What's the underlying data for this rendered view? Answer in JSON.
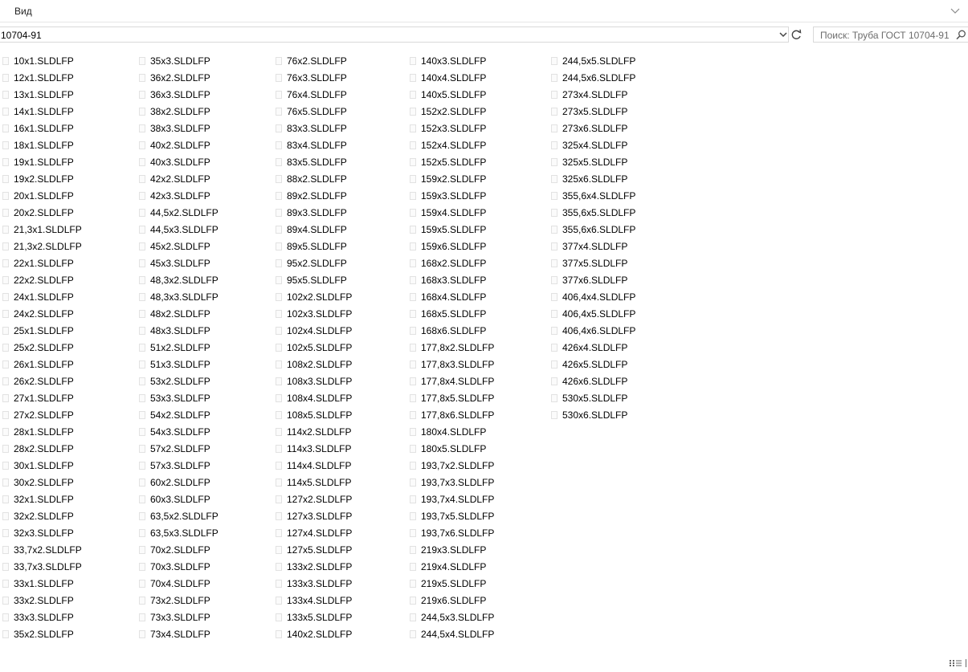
{
  "ribbon": {
    "tab_label": "Вид"
  },
  "address": {
    "path": "10704-91"
  },
  "search": {
    "placeholder": "Поиск: Труба ГОСТ 10704-91"
  },
  "icons": {
    "ribbon": "chevron-down-icon",
    "address": "chevron-down-icon",
    "refresh": "refresh-icon",
    "search": "search-icon",
    "file": "file-icon",
    "view": "details-view-icon"
  },
  "columns": [
    [
      "10x1.SLDLFP",
      "12x1.SLDLFP",
      "13x1.SLDLFP",
      "14x1.SLDLFP",
      "16x1.SLDLFP",
      "18x1.SLDLFP",
      "19x1.SLDLFP",
      "19x2.SLDLFP",
      "20x1.SLDLFP",
      "20x2.SLDLFP",
      "21,3x1.SLDLFP",
      "21,3x2.SLDLFP",
      "22x1.SLDLFP",
      "22x2.SLDLFP",
      "24x1.SLDLFP",
      "24x2.SLDLFP",
      "25x1.SLDLFP",
      "25x2.SLDLFP",
      "26x1.SLDLFP",
      "26x2.SLDLFP",
      "27x1.SLDLFP",
      "27x2.SLDLFP",
      "28x1.SLDLFP",
      "28x2.SLDLFP",
      "30x1.SLDLFP",
      "30x2.SLDLFP",
      "32x1.SLDLFP",
      "32x2.SLDLFP",
      "32x3.SLDLFP",
      "33,7x2.SLDLFP",
      "33,7x3.SLDLFP",
      "33x1.SLDLFP",
      "33x2.SLDLFP",
      "33x3.SLDLFP",
      "35x2.SLDLFP"
    ],
    [
      "35x3.SLDLFP",
      "36x2.SLDLFP",
      "36x3.SLDLFP",
      "38x2.SLDLFP",
      "38x3.SLDLFP",
      "40x2.SLDLFP",
      "40x3.SLDLFP",
      "42x2.SLDLFP",
      "42x3.SLDLFP",
      "44,5x2.SLDLFP",
      "44,5x3.SLDLFP",
      "45x2.SLDLFP",
      "45x3.SLDLFP",
      "48,3x2.SLDLFP",
      "48,3x3.SLDLFP",
      "48x2.SLDLFP",
      "48x3.SLDLFP",
      "51x2.SLDLFP",
      "51x3.SLDLFP",
      "53x2.SLDLFP",
      "53x3.SLDLFP",
      "54x2.SLDLFP",
      "54x3.SLDLFP",
      "57x2.SLDLFP",
      "57x3.SLDLFP",
      "60x2.SLDLFP",
      "60x3.SLDLFP",
      "63,5x2.SLDLFP",
      "63,5x3.SLDLFP",
      "70x2.SLDLFP",
      "70x3.SLDLFP",
      "70x4.SLDLFP",
      "73x2.SLDLFP",
      "73x3.SLDLFP",
      "73x4.SLDLFP"
    ],
    [
      "76x2.SLDLFP",
      "76x3.SLDLFP",
      "76x4.SLDLFP",
      "76x5.SLDLFP",
      "83x3.SLDLFP",
      "83x4.SLDLFP",
      "83x5.SLDLFP",
      "88x2.SLDLFP",
      "89x2.SLDLFP",
      "89x3.SLDLFP",
      "89x4.SLDLFP",
      "89x5.SLDLFP",
      "95x2.SLDLFP",
      "95x5.SLDLFP",
      "102x2.SLDLFP",
      "102x3.SLDLFP",
      "102x4.SLDLFP",
      "102x5.SLDLFP",
      "108x2.SLDLFP",
      "108x3.SLDLFP",
      "108x4.SLDLFP",
      "108x5.SLDLFP",
      "114x2.SLDLFP",
      "114x3.SLDLFP",
      "114x4.SLDLFP",
      "114x5.SLDLFP",
      "127x2.SLDLFP",
      "127x3.SLDLFP",
      "127x4.SLDLFP",
      "127x5.SLDLFP",
      "133x2.SLDLFP",
      "133x3.SLDLFP",
      "133x4.SLDLFP",
      "133x5.SLDLFP",
      "140x2.SLDLFP"
    ],
    [
      "140x3.SLDLFP",
      "140x4.SLDLFP",
      "140x5.SLDLFP",
      "152x2.SLDLFP",
      "152x3.SLDLFP",
      "152x4.SLDLFP",
      "152x5.SLDLFP",
      "159x2.SLDLFP",
      "159x3.SLDLFP",
      "159x4.SLDLFP",
      "159x5.SLDLFP",
      "159x6.SLDLFP",
      "168x2.SLDLFP",
      "168x3.SLDLFP",
      "168x4.SLDLFP",
      "168x5.SLDLFP",
      "168x6.SLDLFP",
      "177,8x2.SLDLFP",
      "177,8x3.SLDLFP",
      "177,8x4.SLDLFP",
      "177,8x5.SLDLFP",
      "177,8x6.SLDLFP",
      "180x4.SLDLFP",
      "180x5.SLDLFP",
      "193,7x2.SLDLFP",
      "193,7x3.SLDLFP",
      "193,7x4.SLDLFP",
      "193,7x5.SLDLFP",
      "193,7x6.SLDLFP",
      "219x3.SLDLFP",
      "219x4.SLDLFP",
      "219x5.SLDLFP",
      "219x6.SLDLFP",
      "244,5x3.SLDLFP",
      "244,5x4.SLDLFP"
    ],
    [
      "244,5x5.SLDLFP",
      "244,5x6.SLDLFP",
      "273x4.SLDLFP",
      "273x5.SLDLFP",
      "273x6.SLDLFP",
      "325x4.SLDLFP",
      "325x5.SLDLFP",
      "325x6.SLDLFP",
      "355,6x4.SLDLFP",
      "355,6x5.SLDLFP",
      "355,6x6.SLDLFP",
      "377x4.SLDLFP",
      "377x5.SLDLFP",
      "377x6.SLDLFP",
      "406,4x4.SLDLFP",
      "406,4x5.SLDLFP",
      "406,4x6.SLDLFP",
      "426x4.SLDLFP",
      "426x5.SLDLFP",
      "426x6.SLDLFP",
      "530x5.SLDLFP",
      "530x6.SLDLFP"
    ]
  ]
}
